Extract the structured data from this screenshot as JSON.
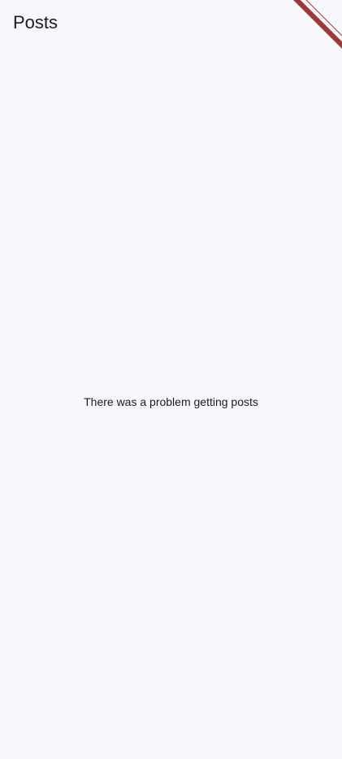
{
  "app_bar": {
    "title": "Posts"
  },
  "debug_banner": {
    "color": "#9c3b3b"
  },
  "main": {
    "error_message": "There was a problem getting posts"
  },
  "colors": {
    "background": "#f7f8fd",
    "text": "#1c1c1e"
  }
}
